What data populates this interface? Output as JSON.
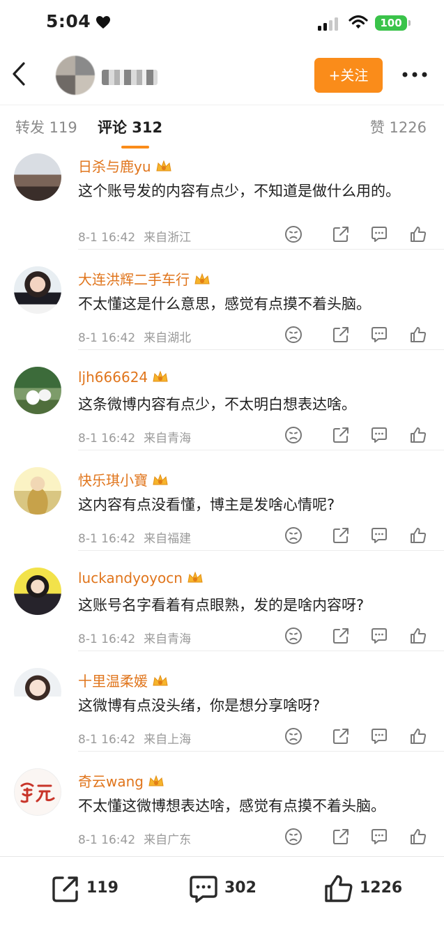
{
  "status_bar": {
    "time": "5:04",
    "battery": "100",
    "icons": [
      "heart-icon",
      "cellular-signal-icon",
      "wifi-icon",
      "battery-icon"
    ]
  },
  "header": {
    "follow_label": "+关注",
    "icons": [
      "back-icon",
      "more-icon"
    ]
  },
  "tabs": {
    "repost": "转发 119",
    "comment": "评论 312",
    "like": "赞 1226",
    "active": "comment"
  },
  "comments": [
    {
      "username": "日杀与鹿yu",
      "text": "这个账号发的内容有点少，不知道是做什么用的。",
      "time": "8-1 16:42",
      "location": "来自浙江"
    },
    {
      "username": "大连洪辉二手车行",
      "text": "不太懂这是什么意思，感觉有点摸不着头脑。",
      "time": "8-1 16:42",
      "location": "来自湖北"
    },
    {
      "username": "ljh666624",
      "text": "这条微博内容有点少，不太明白想表达啥。",
      "time": "8-1 16:42",
      "location": "来自青海"
    },
    {
      "username": "快乐琪小寶",
      "text": "这内容有点没看懂，博主是发啥心情呢?",
      "time": "8-1 16:42",
      "location": "来自福建"
    },
    {
      "username": "luckandyoyocn",
      "text": "这账号名字看着有点眼熟，发的是啥内容呀?",
      "time": "8-1 16:42",
      "location": "来自青海"
    },
    {
      "username": "十里温柔媛",
      "text": "这微博有点没头绪，你是想分享啥呀?",
      "time": "8-1 16:42",
      "location": "来自上海"
    },
    {
      "username": "奇云wang",
      "text": "不太懂这微博想表达啥，感觉有点摸不着头脑。",
      "time": "8-1 16:42",
      "location": "来自广东"
    }
  ],
  "bottom_bar": {
    "repost_count": "119",
    "comment_count": "302",
    "like_count": "1226"
  },
  "colors": {
    "accent": "#fa8c1a",
    "username": "#e0751c",
    "meta": "#9a9a9a"
  }
}
